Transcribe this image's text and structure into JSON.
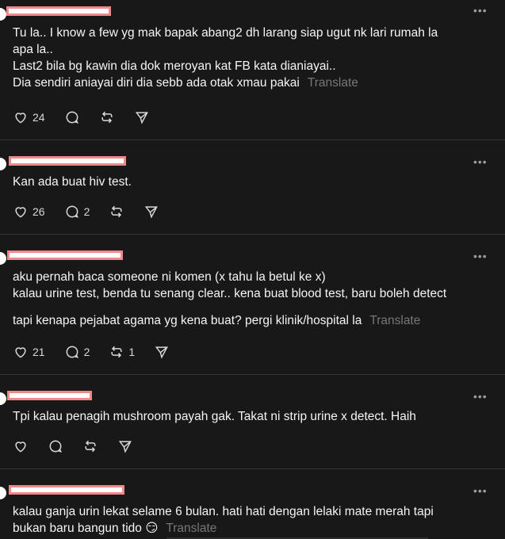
{
  "actions": {
    "like_icon": "heart-icon",
    "reply_icon": "comment-icon",
    "repost_icon": "repost-icon",
    "share_icon": "send-icon"
  },
  "translate_label": "Translate",
  "posts": [
    {
      "lines": [
        "Tu la.. I know a few yg mak bapak abang2 dh larang siap ugut nk lari rumah la",
        "apa la..",
        "Last2 bila bg kawin dia dok meroyan kat FB kata dianiayai..",
        "Dia sendiri aniayai diri dia sebb ada otak xmau pakai"
      ],
      "likes": "24",
      "replies": "",
      "reposts": ""
    },
    {
      "lines": [
        "Kan ada buat hiv test."
      ],
      "likes": "26",
      "replies": "2",
      "reposts": ""
    },
    {
      "lines": [
        "aku pernah baca someone ni komen (x tahu la betul ke x)",
        "kalau urine test, benda tu senang clear.. kena buat blood test, baru boleh detect",
        "tapi kenapa pejabat agama yg kena buat? pergi klinik/hospital la"
      ],
      "likes": "21",
      "replies": "2",
      "reposts": "1"
    },
    {
      "lines": [
        "Tpi kalau penagih mushroom payah gak. Takat ni strip urine x detect. Haih"
      ],
      "likes": "",
      "replies": "",
      "reposts": ""
    },
    {
      "lines": [
        "kalau ganja urin lekat selame 6 bulan. hati hati dengan lelaki mate merah tapi",
        "bukan baru bangun tido 😏"
      ],
      "likes": "",
      "replies": "",
      "reposts": ""
    }
  ]
}
